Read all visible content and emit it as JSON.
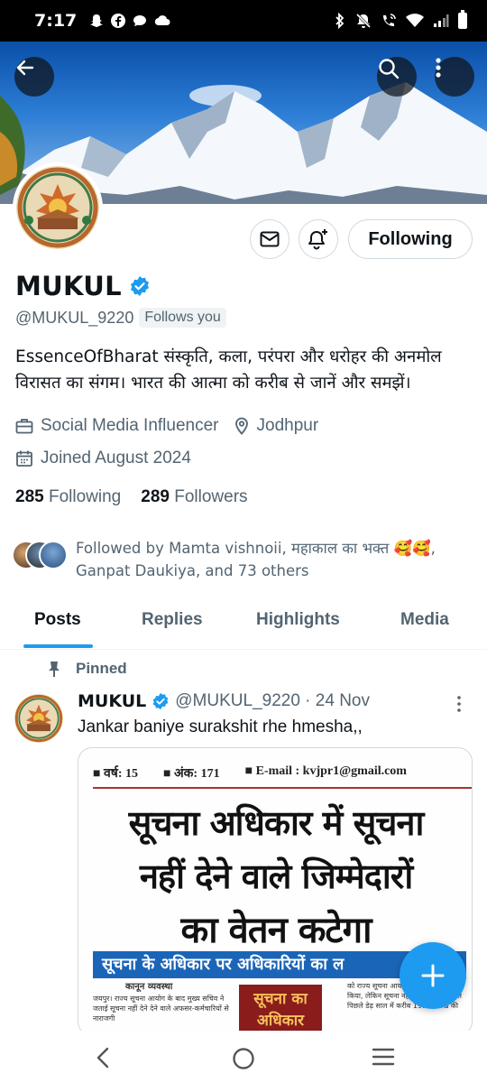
{
  "status_bar": {
    "time": "7:17",
    "left_icons": [
      "snapchat-icon",
      "facebook-icon",
      "chat-bubble-icon",
      "cloud-icon"
    ],
    "right_icons": [
      "bluetooth-icon",
      "mute-icon",
      "wifi-call-icon",
      "wifi-icon",
      "signal-icon",
      "battery-icon"
    ]
  },
  "header": {
    "back_icon": "arrow-left-icon",
    "search_icon": "search-icon",
    "more_icon": "more-vertical-icon"
  },
  "profile": {
    "name": "MUKUL",
    "handle": "@MUKUL_9220",
    "follows_you": "Follows you",
    "bio": "EssenceOfBharat  संस्कृति, कला, परंपरा और धरोहर की अनमोल विरासत का संगम। भारत की आत्मा को करीब से जानें और समझें।",
    "category": "Social Media Influencer",
    "location": "Jodhpur",
    "joined": "Joined August 2024",
    "following_count": "285",
    "following_label": "Following",
    "followers_count": "289",
    "followers_label": "Followers",
    "followed_by_line1": "Followed by Mamta vishnoii, महाकाल का भक्त 🥰🥰,",
    "followed_by_line2": "Ganpat Daukiya, and 73 others"
  },
  "actions": {
    "message_icon": "envelope-icon",
    "notify_icon": "bell-plus-icon",
    "following_button": "Following"
  },
  "tabs": [
    {
      "label": "Posts",
      "active": true
    },
    {
      "label": "Replies",
      "active": false
    },
    {
      "label": "Highlights",
      "active": false
    },
    {
      "label": "Media",
      "active": false
    }
  ],
  "pinned_post": {
    "pinned_label": "Pinned",
    "author_name": "MUKUL",
    "author_handle": "@MUKUL_9220 · 24 Nov",
    "text": "Jankar baniye surakshit rhe hmesha,,",
    "media": {
      "issue_year": "वर्ष: 15",
      "issue_number": "अंक: 171",
      "email": "E-mail : kvjpr1@gmail.com",
      "headline_line1": "सूचना अधिकार में सूचना",
      "headline_line2": "नहीं देने वाले जिम्मेदारों",
      "headline_line3": "का वेतन कटेगा",
      "sub_banner": "सूचना के अधिकार पर अधिकारियों का ल",
      "column_heading": "कानून व्यवस्था",
      "column_left": "जयपुर। राज्य सूचना आयोग के बाद मुख्य सचिव ने जताई सूचना नहीं देने देने वाले अफसर-कर्मचारियों से नाराजगी",
      "red_box": "सूचना का अधिकार",
      "column_right": "को राज्य सूचना आयोग ने दोषी जुर्माना किया, लेकिन सूचना नहीं देने वाले दोषियों से पिछले डेढ़ साल में करीब 19.50 लाख की"
    }
  },
  "fab": {
    "icon": "plus-icon"
  },
  "nav": {
    "back_icon": "nav-back-icon",
    "home_icon": "nav-home-icon",
    "recents_icon": "nav-recents-icon"
  },
  "colors": {
    "accent": "#1d9bf0",
    "text_primary": "#0f1419",
    "text_secondary": "#536471",
    "border": "#cfd9de"
  }
}
